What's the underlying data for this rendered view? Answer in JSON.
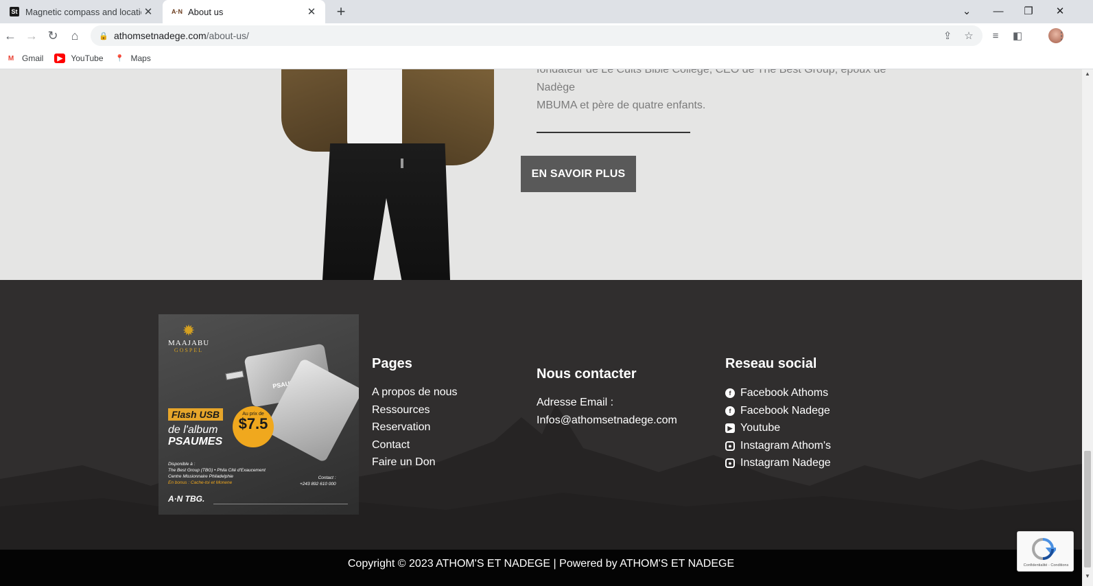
{
  "browser": {
    "tabs": [
      {
        "title": "Magnetic compass and location",
        "favicon": "St",
        "active": false
      },
      {
        "title": "About us",
        "favicon": "A·N",
        "active": true
      }
    ],
    "url_domain": "athomsetnadege.com",
    "url_path": "/about-us/",
    "bookmarks": [
      {
        "label": "Gmail",
        "icon": "gmail-icon"
      },
      {
        "label": "YouTube",
        "icon": "youtube-icon"
      },
      {
        "label": "Maps",
        "icon": "maps-icon"
      }
    ]
  },
  "about": {
    "bio_line1": "fondateur de Le Cults Bible College, CEO de The Best Group, époux de Nadège",
    "bio_line2": "MBUMA et père de quatre enfants.",
    "more_button": "EN SAVOIR PLUS"
  },
  "promo": {
    "brand_name": "MAAJABU",
    "brand_sub": "GOSPEL",
    "card_label": "PSAUMES",
    "flash_label": "Flash USB",
    "album_line": "de l'album",
    "album_name": "PSAUMES",
    "price_prefix": "Au prix de",
    "price": "$7.5",
    "available_title": "Disponible à :",
    "available_line1": "The Best Group (TBG) • Phila Cité d'Exaucement",
    "available_line2": "Centre Missionnaire Philadelphie",
    "bonus": "En bonus : Cache-toi et Monene",
    "contact_title": "Contact :",
    "contact_phone": "+243 892 610 000",
    "logos": "A·N  TBG."
  },
  "footer": {
    "pages_title": "Pages",
    "pages_links": [
      "A propos de nous",
      "Ressources",
      "Reservation",
      "Contact",
      "Faire un Don"
    ],
    "contact_title": "Nous contacter",
    "contact_label": "Adresse Email :",
    "contact_email": "Infos@athomsetnadege.com",
    "social_title": "Reseau social",
    "social_links": [
      {
        "label": "Facebook Athoms",
        "icon": "facebook-icon"
      },
      {
        "label": "Facebook Nadege",
        "icon": "facebook-icon"
      },
      {
        "label": "Youtube",
        "icon": "youtube-icon"
      },
      {
        "label": "Instagram Athom's",
        "icon": "instagram-icon"
      },
      {
        "label": "Instagram Nadege",
        "icon": "instagram-icon"
      }
    ],
    "copyright": "Copyright © 2023 ATHOM'S ET NADEGE | Powered by ATHOM'S ET NADEGE"
  },
  "recaptcha": {
    "terms": "Confidentialité - Conditions"
  },
  "colors": {
    "about_bg": "#e5e5e4",
    "footer_bg": "#302e2e",
    "button_bg": "#595959",
    "copyright_bg": "#040404",
    "accent_gold": "#f0a81e"
  }
}
